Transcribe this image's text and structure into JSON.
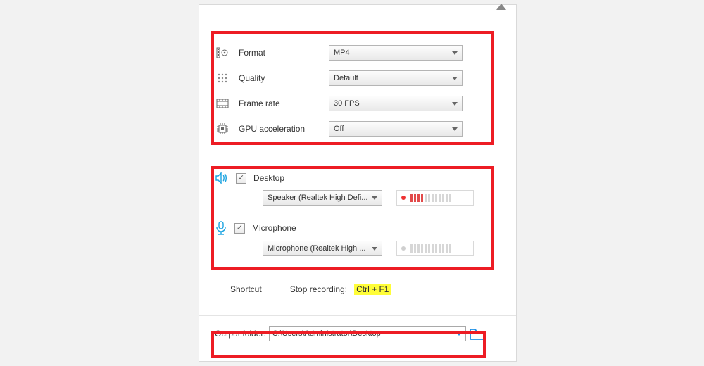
{
  "video": {
    "format": {
      "label": "Format",
      "value": "MP4"
    },
    "quality": {
      "label": "Quality",
      "value": "Default"
    },
    "framerate": {
      "label": "Frame rate",
      "value": "30 FPS"
    },
    "gpu": {
      "label": "GPU acceleration",
      "value": "Off"
    }
  },
  "audio": {
    "desktop": {
      "label": "Desktop",
      "checked": true,
      "device": "Speaker (Realtek High Defi...",
      "active": true,
      "level": 4
    },
    "mic": {
      "label": "Microphone",
      "checked": true,
      "device": "Microphone (Realtek High ...",
      "active": false,
      "level": 0
    }
  },
  "shortcut": {
    "heading": "Shortcut",
    "stop_label": "Stop recording:",
    "stop_key": "Ctrl + F1"
  },
  "output": {
    "label": "Output folder:",
    "path": "C:\\Users\\Administrator\\Desktop"
  }
}
